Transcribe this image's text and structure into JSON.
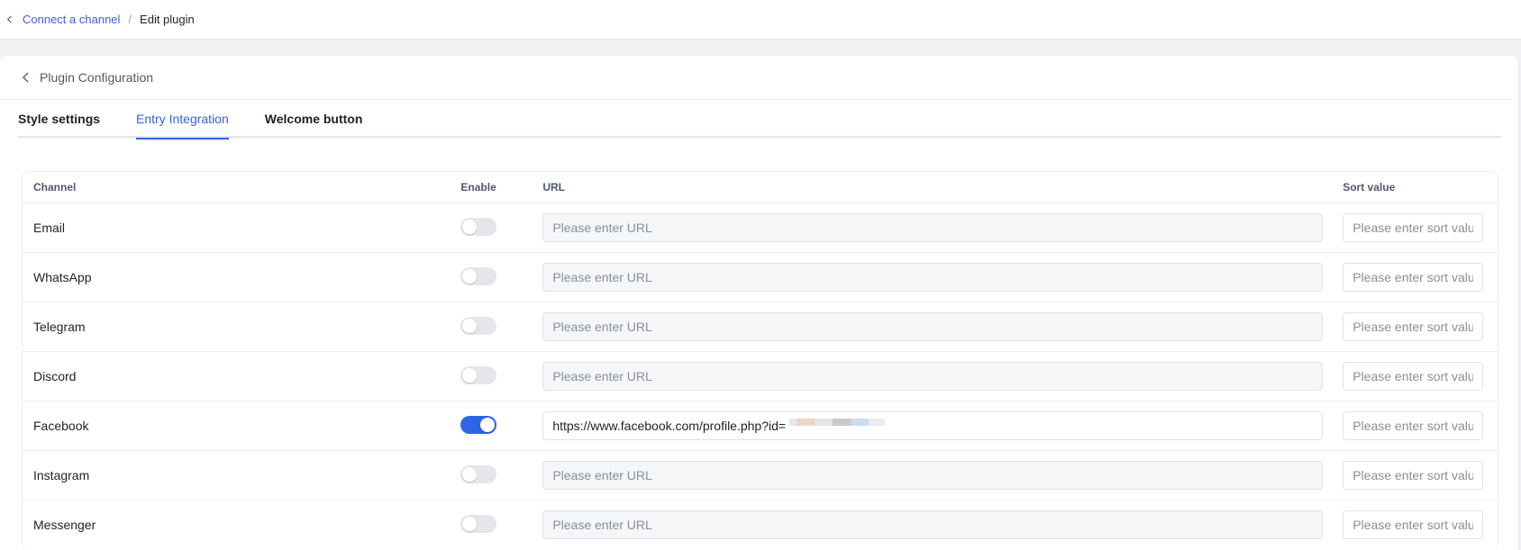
{
  "breadcrumb": {
    "parent": "Connect a channel",
    "separator": "/",
    "current": "Edit plugin"
  },
  "panel": {
    "title": "Plugin Configuration"
  },
  "tabs": [
    {
      "label": "Style settings",
      "active": false
    },
    {
      "label": "Entry Integration",
      "active": true
    },
    {
      "label": "Welcome button",
      "active": false
    }
  ],
  "table": {
    "headers": {
      "channel": "Channel",
      "enable": "Enable",
      "url": "URL",
      "sort": "Sort value"
    },
    "rows": [
      {
        "channel": "Email",
        "enabled": false,
        "url": "",
        "url_placeholder": "Please enter URL",
        "sort": "",
        "sort_placeholder": "Please enter sort value"
      },
      {
        "channel": "WhatsApp",
        "enabled": false,
        "url": "",
        "url_placeholder": "Please enter URL",
        "sort": "",
        "sort_placeholder": "Please enter sort value"
      },
      {
        "channel": "Telegram",
        "enabled": false,
        "url": "",
        "url_placeholder": "Please enter URL",
        "sort": "",
        "sort_placeholder": "Please enter sort value"
      },
      {
        "channel": "Discord",
        "enabled": false,
        "url": "",
        "url_placeholder": "Please enter URL",
        "sort": "",
        "sort_placeholder": "Please enter sort value"
      },
      {
        "channel": "Facebook",
        "enabled": true,
        "url": "https://www.facebook.com/profile.php?id=",
        "url_placeholder": "Please enter URL",
        "sort": "",
        "sort_placeholder": "Please enter sort value"
      },
      {
        "channel": "Instagram",
        "enabled": false,
        "url": "",
        "url_placeholder": "Please enter URL",
        "sort": "",
        "sort_placeholder": "Please enter sort value"
      },
      {
        "channel": "Messenger",
        "enabled": false,
        "url": "",
        "url_placeholder": "Please enter URL",
        "sort": "",
        "sort_placeholder": "Please enter sort value"
      }
    ]
  },
  "colors": {
    "accent": "#2f64e8",
    "link": "#3d5ee0",
    "toggle_off": "#e5e6eb"
  },
  "icons": {
    "breadcrumb_back": "chevron-left-icon",
    "panel_back": "chevron-left-icon"
  }
}
